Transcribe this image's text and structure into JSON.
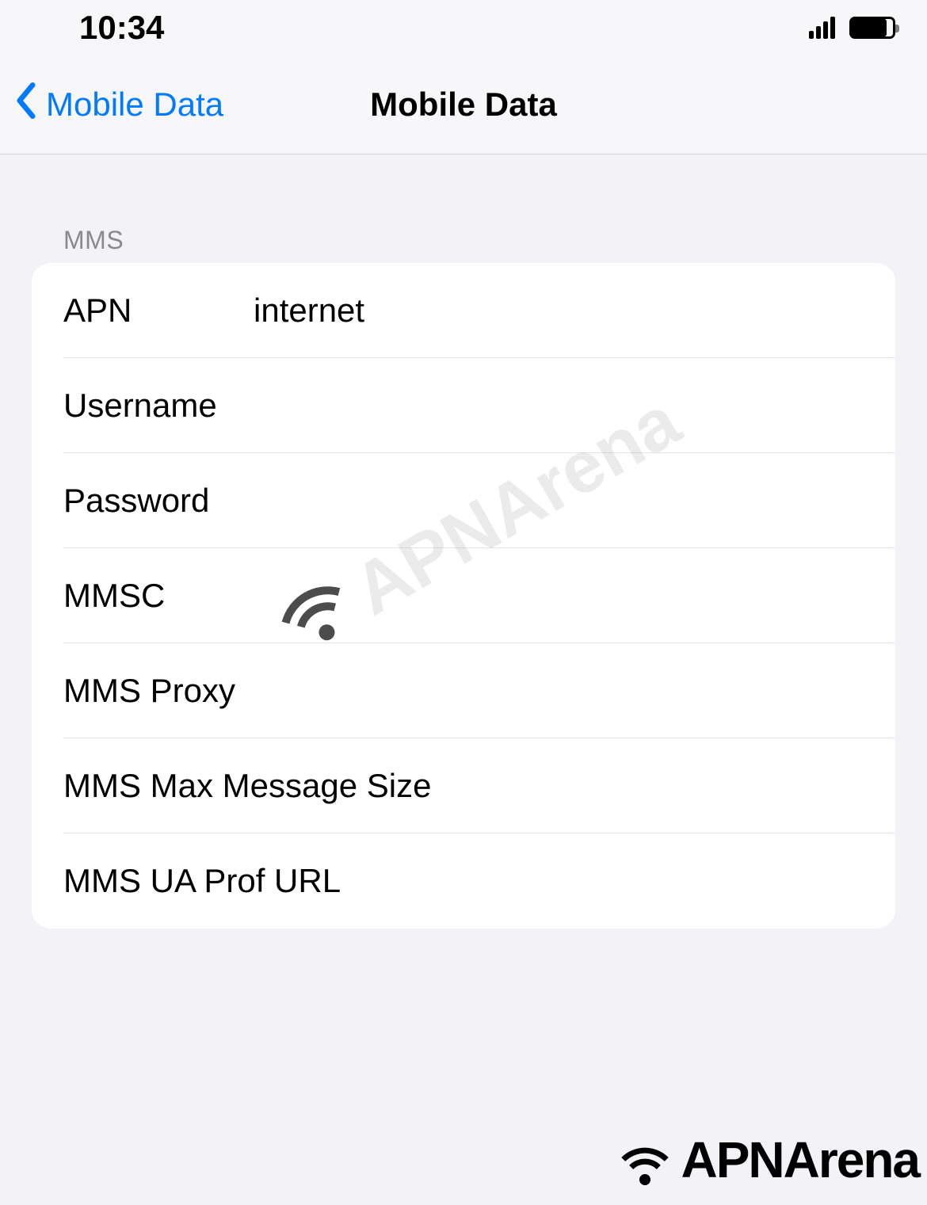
{
  "status": {
    "time": "10:34"
  },
  "nav": {
    "back_label": "Mobile Data",
    "title": "Mobile Data"
  },
  "section": {
    "header": "MMS"
  },
  "fields": {
    "apn": {
      "label": "APN",
      "value": "internet"
    },
    "username": {
      "label": "Username",
      "value": ""
    },
    "password": {
      "label": "Password",
      "value": ""
    },
    "mmsc": {
      "label": "MMSC",
      "value": ""
    },
    "mms_proxy": {
      "label": "MMS Proxy",
      "value": ""
    },
    "mms_max": {
      "label": "MMS Max Message Size",
      "value": ""
    },
    "mms_ua": {
      "label": "MMS UA Prof URL",
      "value": ""
    }
  },
  "watermark": {
    "text": "APNArena"
  },
  "brand": {
    "text": "APNArena"
  }
}
